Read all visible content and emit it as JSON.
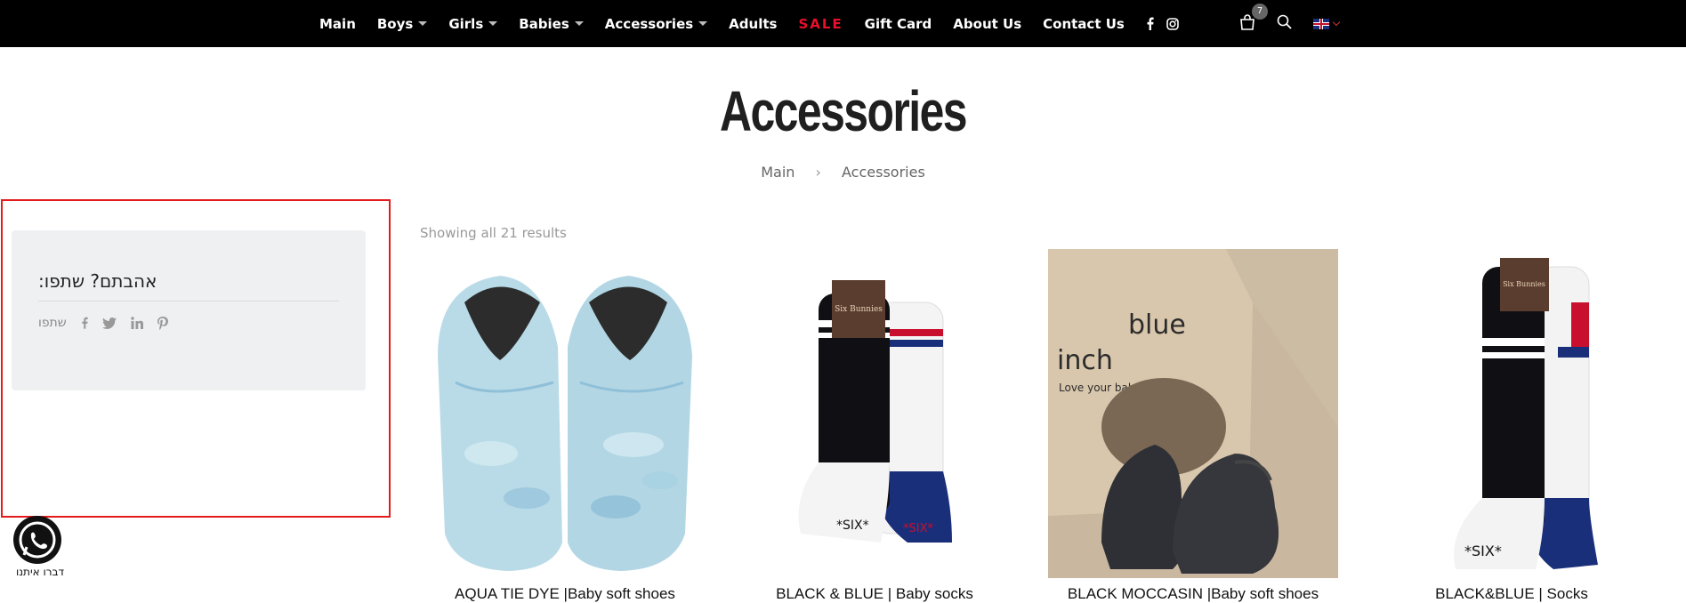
{
  "nav": {
    "items": [
      {
        "label": "Main",
        "has_dropdown": false
      },
      {
        "label": "Boys",
        "has_dropdown": true
      },
      {
        "label": "Girls",
        "has_dropdown": true
      },
      {
        "label": "Babies",
        "has_dropdown": true
      },
      {
        "label": "Accessories",
        "has_dropdown": true
      },
      {
        "label": "Adults",
        "has_dropdown": false
      },
      {
        "label": "SALE",
        "has_dropdown": false,
        "color": "#e8102a"
      },
      {
        "label": "Gift Card",
        "has_dropdown": false
      },
      {
        "label": "About Us",
        "has_dropdown": false
      },
      {
        "label": "Contact Us",
        "has_dropdown": false
      }
    ],
    "social_icons": [
      "facebook-icon",
      "instagram-icon"
    ],
    "cart_count": "7",
    "language_flag": "uk-flag-icon"
  },
  "page": {
    "title": "Accessories",
    "breadcrumb": [
      "Main",
      "Accessories"
    ]
  },
  "sidebar": {
    "share_title": "אהבתם? שתפו:",
    "share_label": "שתפו",
    "share_icons": [
      "facebook-icon",
      "twitter-icon",
      "linkedin-icon",
      "pinterest-icon"
    ]
  },
  "shop": {
    "results_text": "Showing all 21 results",
    "products": [
      {
        "name": "AQUA TIE DYE |Baby soft shoes"
      },
      {
        "name": "BLACK & BLUE | Baby socks"
      },
      {
        "name": "BLACK MOCCASIN |Baby soft shoes"
      },
      {
        "name": "BLACK&BLUE | Socks"
      }
    ]
  },
  "whatsapp": {
    "label": "דברו איתנו"
  },
  "colors": {
    "topbar": "#000000",
    "sale": "#e8102a",
    "highlight_box": "#e31b1b"
  }
}
